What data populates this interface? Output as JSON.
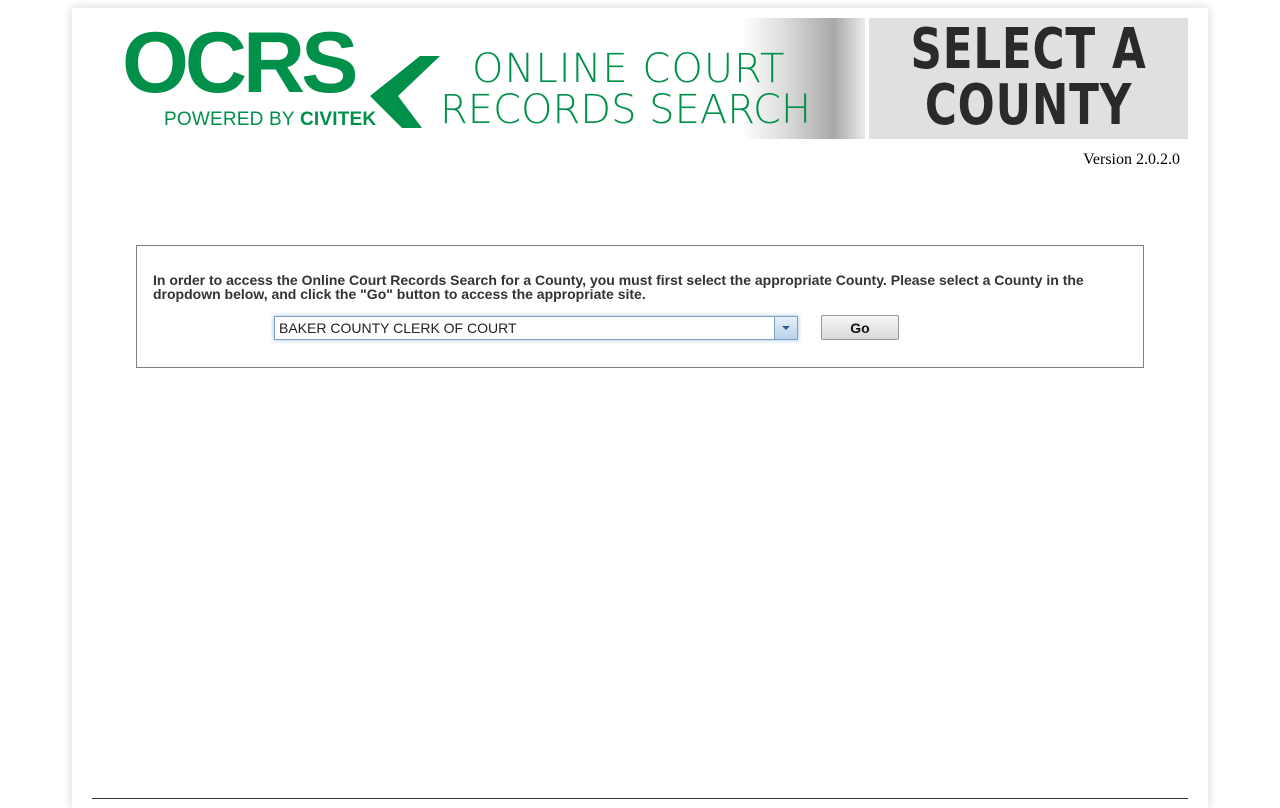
{
  "header": {
    "logo_text": "OCRS",
    "powered_by_prefix": "POWERED BY ",
    "powered_by_brand": "CIVITEK",
    "site_title_line1": "ONLINE COURT",
    "site_title_line2": "RECORDS SEARCH",
    "page_heading_line1": "SELECT A",
    "page_heading_line2": "COUNTY",
    "version": "Version 2.0.2.0"
  },
  "form": {
    "instructions": "In order to access the Online Court Records Search for a County, you must first select the appropriate County. Please select a County in the dropdown below, and click the \"Go\" button to access the appropriate site.",
    "county_select": {
      "selected": "BAKER COUNTY CLERK OF COURT"
    },
    "go_label": "Go"
  },
  "colors": {
    "brand_green": "#00904a",
    "heading_dark": "#2a2a2a",
    "heading_bg": "#e0e0e0"
  },
  "icons": {
    "logo_chevron": "left-chevron-icon",
    "dropdown_arrow": "chevron-down-icon"
  }
}
